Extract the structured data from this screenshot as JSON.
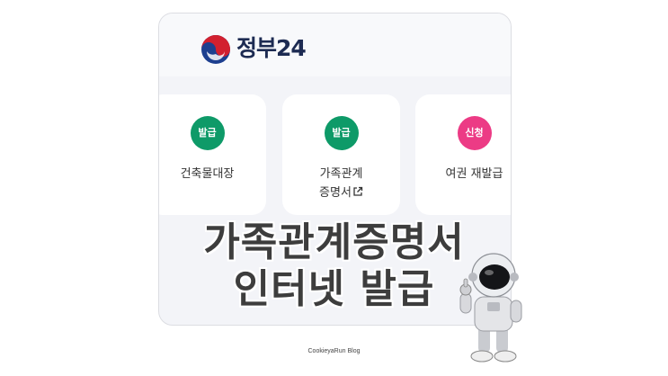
{
  "header": {
    "logo_text": "정부24"
  },
  "cards": [
    {
      "badge": "발급",
      "badge_color": "#0e9a68",
      "label_line1": "건축물대장",
      "label_line2": "",
      "external_link": false
    },
    {
      "badge": "발급",
      "badge_color": "#0e9a68",
      "label_line1": "가족관계",
      "label_line2": "증명서",
      "external_link": true
    },
    {
      "badge": "신청",
      "badge_color": "#ec3b85",
      "label_line1": "여권 재발급",
      "label_line2": "",
      "external_link": false
    }
  ],
  "headline": {
    "line1": "가족관계증명서",
    "line2": "인터넷 발급"
  },
  "credit": "CookieyaRun Blog",
  "icons": {
    "logo": "taegeuk-emblem-icon",
    "external": "external-link-icon",
    "character": "astronaut-illustration"
  },
  "colors": {
    "issue_badge": "#0e9a68",
    "apply_badge": "#ec3b85",
    "logo_text": "#1d2b52"
  }
}
